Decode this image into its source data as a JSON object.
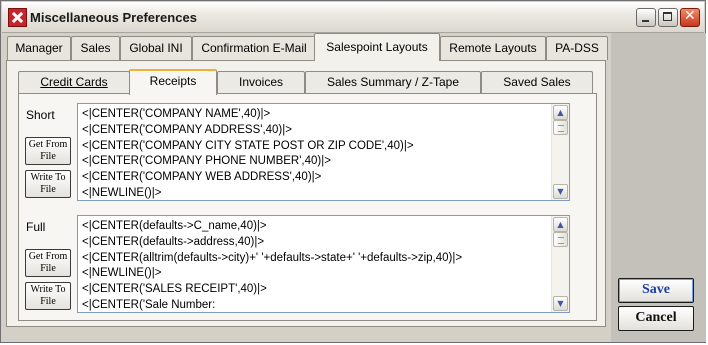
{
  "window": {
    "title": "Miscellaneous Preferences"
  },
  "main_tabs": [
    "Manager",
    "Sales",
    "Global INI",
    "Confirmation E-Mail",
    "Salespoint Layouts",
    "Remote Layouts",
    "PA-DSS"
  ],
  "sub_tabs": [
    "Credit Cards",
    "Receipts",
    "Invoices",
    "Sales Summary / Z-Tape",
    "Saved Sales"
  ],
  "short": {
    "label": "Short",
    "get_btn": [
      "Get From",
      "File"
    ],
    "write_btn": [
      "Write To",
      "File"
    ],
    "lines": [
      "<|CENTER('COMPANY NAME',40)|>",
      "<|CENTER('COMPANY ADDRESS',40)|>",
      "<|CENTER('COMPANY CITY STATE POST OR ZIP CODE',40)|>",
      "<|CENTER('COMPANY PHONE NUMBER',40)|>",
      "<|CENTER('COMPANY WEB ADDRESS',40)|>",
      "<|NEWLINE()|>"
    ]
  },
  "full": {
    "label": "Full",
    "get_btn": [
      "Get From",
      "File"
    ],
    "write_btn": [
      "Write To",
      "File"
    ],
    "lines": [
      "<|CENTER(defaults->C_name,40)|>",
      "<|CENTER(defaults->address,40)|>",
      "<|CENTER(alltrim(defaults->city)+'  '+defaults->state+'  '+defaults->zip,40)|>",
      "<|NEWLINE()|>",
      "<|CENTER('SALES RECEIPT',40)|>",
      "<|CENTER('Sale Number:"
    ]
  },
  "buttons": {
    "save": "Save",
    "cancel": "Cancel"
  },
  "icons": {
    "app": "app-logo-icon",
    "minimize": "minimize-icon",
    "maximize": "maximize-icon",
    "close": "close-icon"
  },
  "colors": {
    "accent_tab": "#f0b13c",
    "save_text": "#1b3fa0",
    "close_button": "#c8381c"
  }
}
